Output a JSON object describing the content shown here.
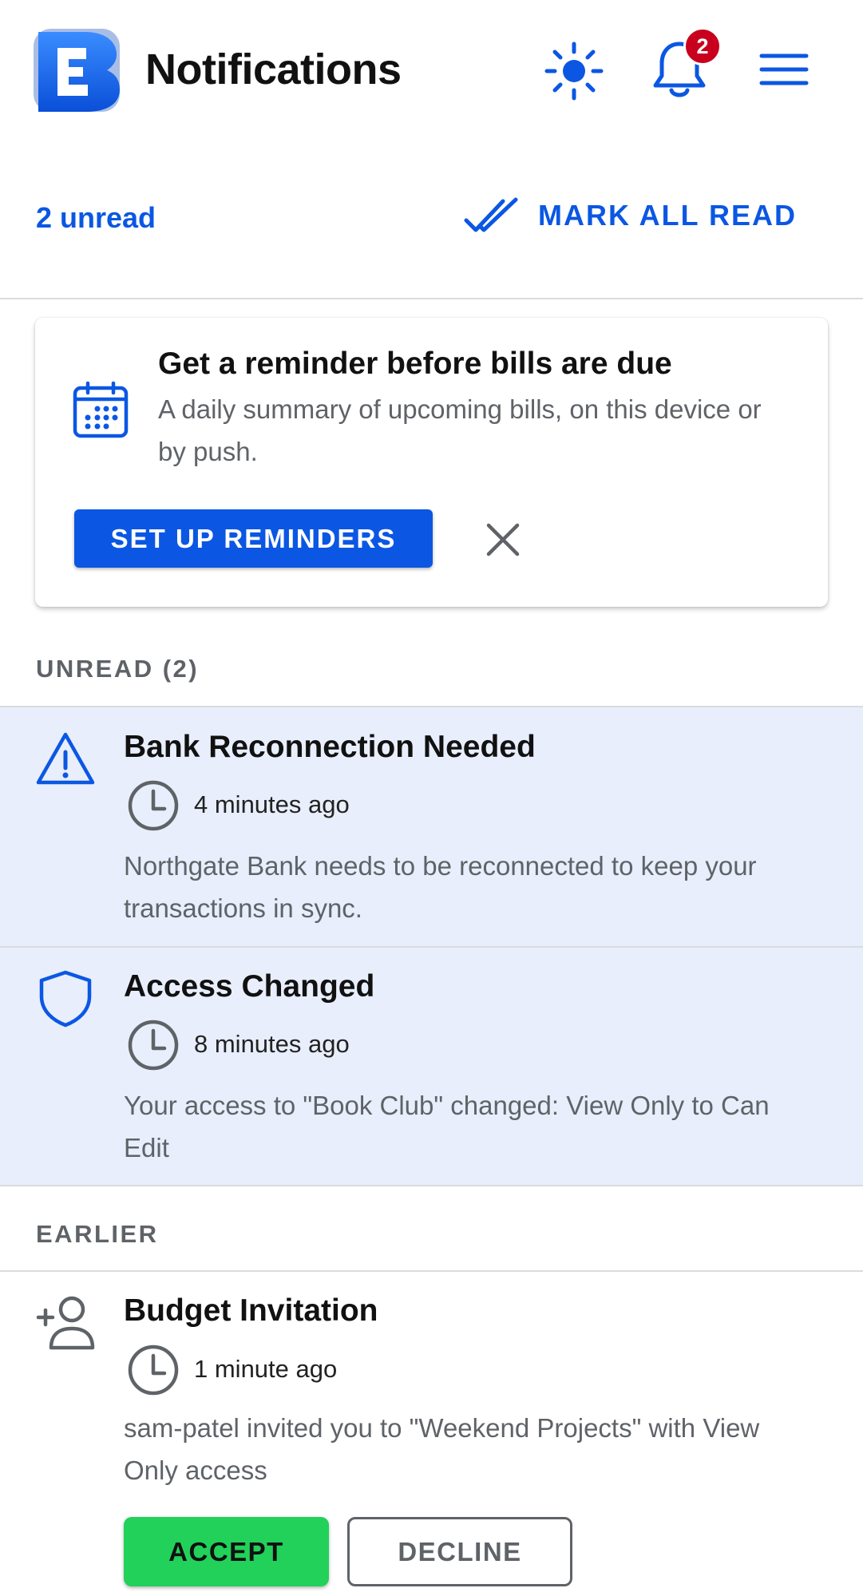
{
  "header": {
    "title": "Notifications",
    "notification_badge": "2",
    "icons": [
      "app-logo",
      "sun-icon",
      "bell-icon",
      "menu-icon"
    ]
  },
  "summary": {
    "unread_label": "2 unread",
    "mark_all_label": "MARK ALL READ"
  },
  "reminder_card": {
    "title": "Get a reminder before bills are due",
    "subtitle": "A daily summary of upcoming bills, on this device or by push.",
    "setup_button": "SET UP REMINDERS",
    "icon": "calendar-icon"
  },
  "sections": {
    "unread": "UNREAD (2)",
    "earlier": "EARLIER"
  },
  "notifications": [
    {
      "icon": "warning-icon",
      "title": "Bank Reconnection Needed",
      "time": "4 minutes ago",
      "body": "Northgate Bank needs to be reconnected to keep your transactions in sync.",
      "unread": true
    },
    {
      "icon": "shield-icon",
      "title": "Access Changed",
      "time": "8 minutes ago",
      "body": "Your access to \"Book Club\" changed: View Only to Can Edit",
      "unread": true
    },
    {
      "icon": "add-person-icon",
      "title": "Budget Invitation",
      "time": "1 minute ago",
      "body": "sam-patel invited you to \"Weekend Projects\" with View Only access",
      "unread": false,
      "actions": {
        "accept": "ACCEPT",
        "decline": "DECLINE"
      }
    }
  ],
  "colors": {
    "accent": "#0b57e3",
    "unread_background": "#e8eefb",
    "badge": "#c8001e",
    "accept": "#22d15a",
    "muted_text": "#5f6368"
  }
}
